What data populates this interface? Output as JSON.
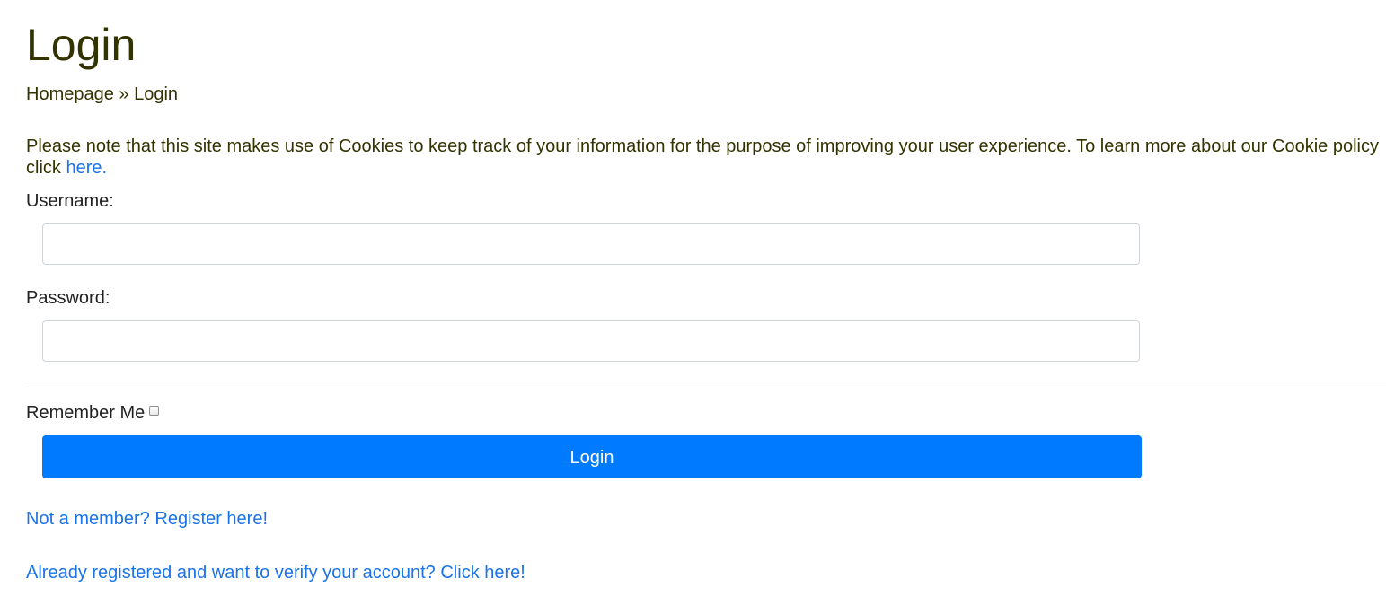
{
  "page": {
    "title": "Login"
  },
  "breadcrumb": {
    "home": "Homepage",
    "separator": " » ",
    "current": "Login"
  },
  "cookie_notice": {
    "text": "Please note that this site makes use of Cookies to keep track of your information for the purpose of improving your user experience. To learn more about our Cookie policy click ",
    "link_label": "here."
  },
  "form": {
    "username_label": "Username:",
    "username_value": "",
    "username_placeholder": "",
    "password_label": "Password:",
    "password_value": "",
    "password_placeholder": "",
    "remember_label": "Remember Me",
    "remember_checked": false,
    "submit_label": "Login"
  },
  "links": {
    "register": "Not a member? Register here!",
    "verify": "Already registered and want to verify your account? Click here!"
  },
  "colors": {
    "text": "#333300",
    "link": "#1a73e8",
    "button_bg": "#007bff",
    "button_text": "#ffffff"
  }
}
